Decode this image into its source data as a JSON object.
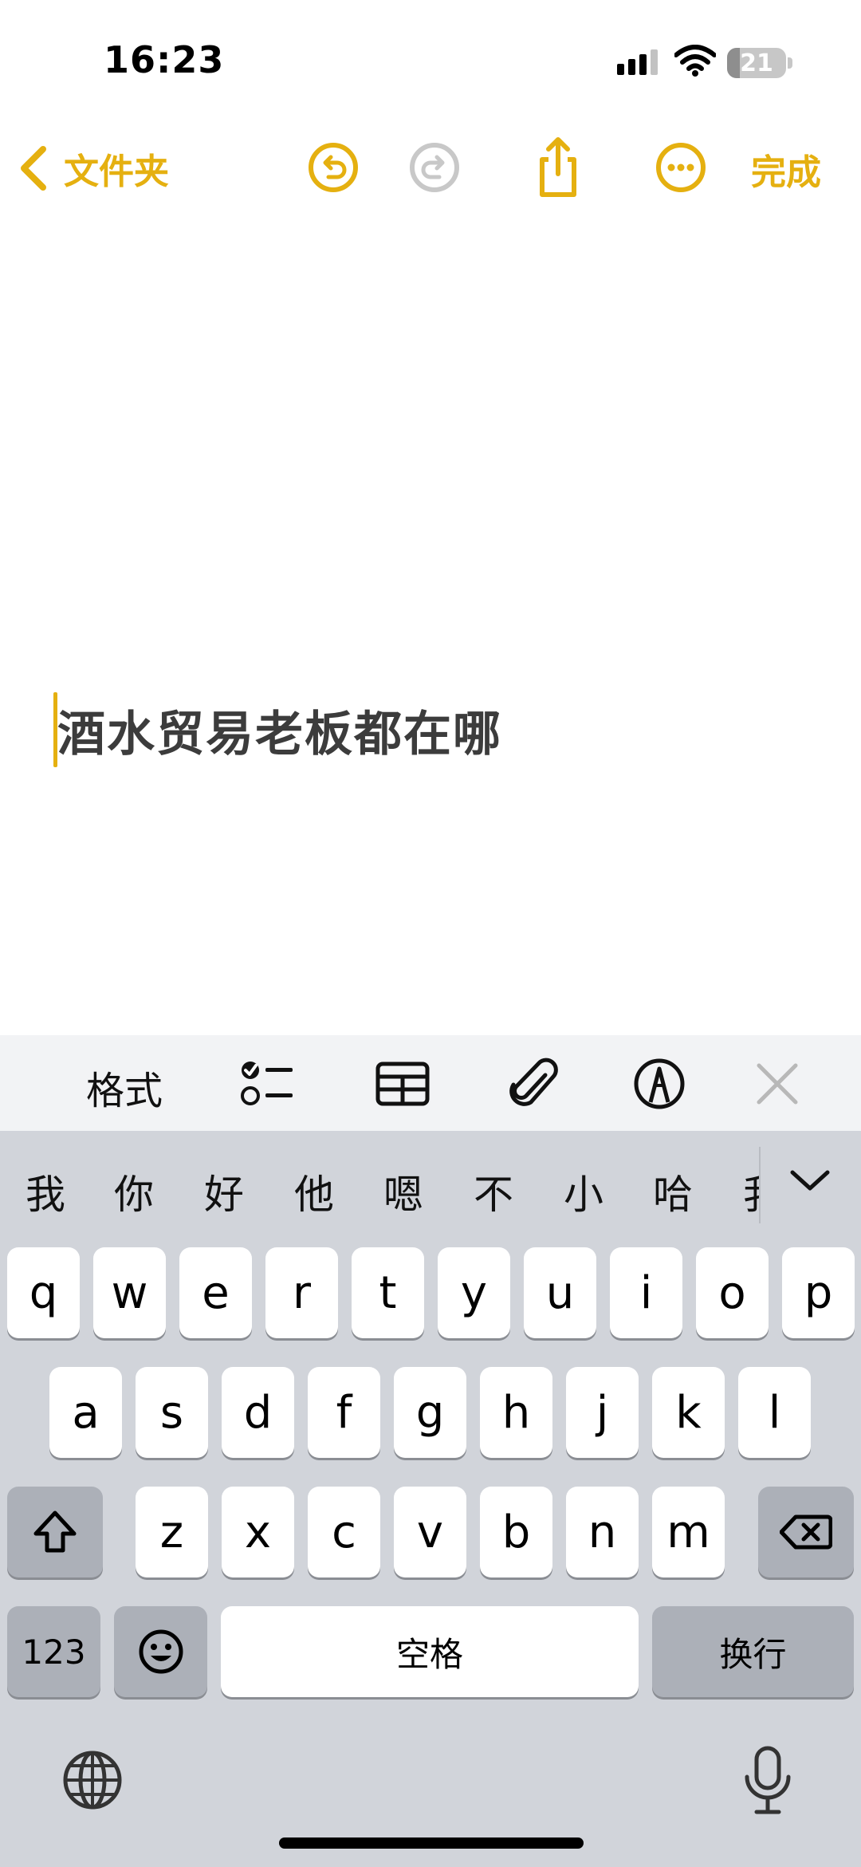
{
  "status_bar": {
    "time": "16:23",
    "battery_level": "21"
  },
  "nav": {
    "back_label": "文件夹",
    "done_label": "完成",
    "icons": [
      "chevron-left-icon",
      "undo-icon",
      "redo-icon",
      "share-icon",
      "more-icon"
    ]
  },
  "note": {
    "text": "酒水贸易老板都在哪"
  },
  "toolbar": {
    "format_label": "格式",
    "icons": [
      "checklist-icon",
      "table-icon",
      "attachment-icon",
      "markup-icon",
      "close-icon"
    ]
  },
  "keyboard": {
    "candidates": [
      "我",
      "你",
      "好",
      "他",
      "嗯",
      "不",
      "小",
      "哈",
      "我"
    ],
    "row1": [
      "q",
      "w",
      "e",
      "r",
      "t",
      "y",
      "u",
      "i",
      "o",
      "p"
    ],
    "row2": [
      "a",
      "s",
      "d",
      "f",
      "g",
      "h",
      "j",
      "k",
      "l"
    ],
    "row3": [
      "z",
      "x",
      "c",
      "v",
      "b",
      "n",
      "m"
    ],
    "numbers_label": "123",
    "space_label": "空格",
    "return_label": "换行",
    "icons": [
      "shift-icon",
      "backspace-icon",
      "emoji-icon",
      "globe-icon",
      "microphone-icon",
      "chevron-down-icon"
    ]
  },
  "colors": {
    "accent": "#e5b010",
    "keyboard_bg": "#d1d4da",
    "key_bg": "#ffffff",
    "dark_key_bg": "#acb0b8",
    "toolbar_bg": "#f2f3f5"
  }
}
